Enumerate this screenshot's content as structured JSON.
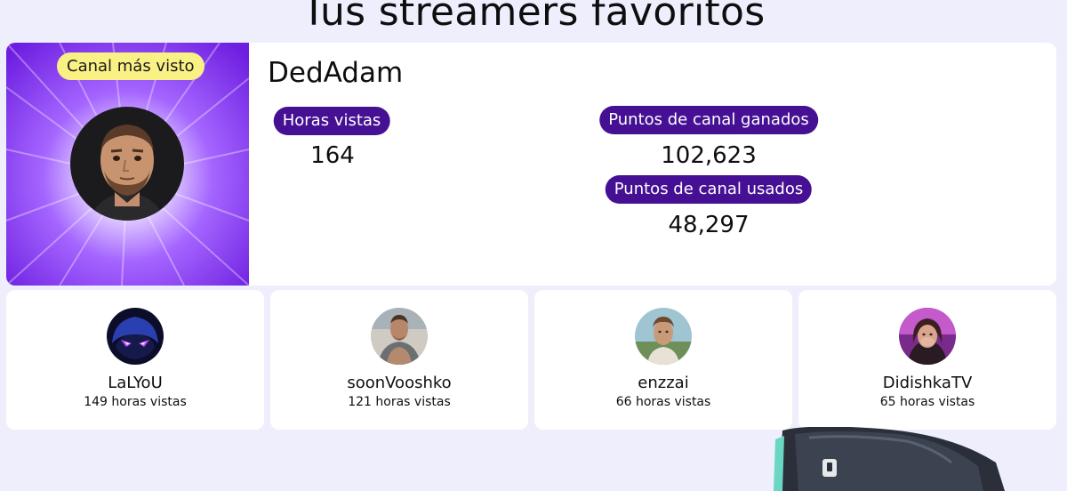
{
  "page": {
    "title": "Tus streamers favoritos"
  },
  "featured": {
    "badge": "Canal más visto",
    "name": "DedAdam",
    "stats": [
      {
        "label": "Horas vistas",
        "value": "164"
      },
      {
        "label": "Puntos de canal ganados",
        "value": "102,623"
      },
      {
        "label": "Puntos de canal usados",
        "value": "48,297"
      }
    ]
  },
  "streamers": [
    {
      "name": "LaLYoU",
      "hours": "149 horas vistas",
      "avatar_icon": "purple-creature-avatar"
    },
    {
      "name": "soonVooshko",
      "hours": "121 horas vistas",
      "avatar_icon": "man-photo-avatar"
    },
    {
      "name": "enzzai",
      "hours": "66 horas vistas",
      "avatar_icon": "young-man-photo-avatar"
    },
    {
      "name": "DidishkaTV",
      "hours": "65 horas vistas",
      "avatar_icon": "woman-photo-avatar"
    }
  ],
  "colors": {
    "background": "#efeefc",
    "pill": "#451093",
    "badge": "#faf185",
    "burst": "#8c3cf0"
  }
}
